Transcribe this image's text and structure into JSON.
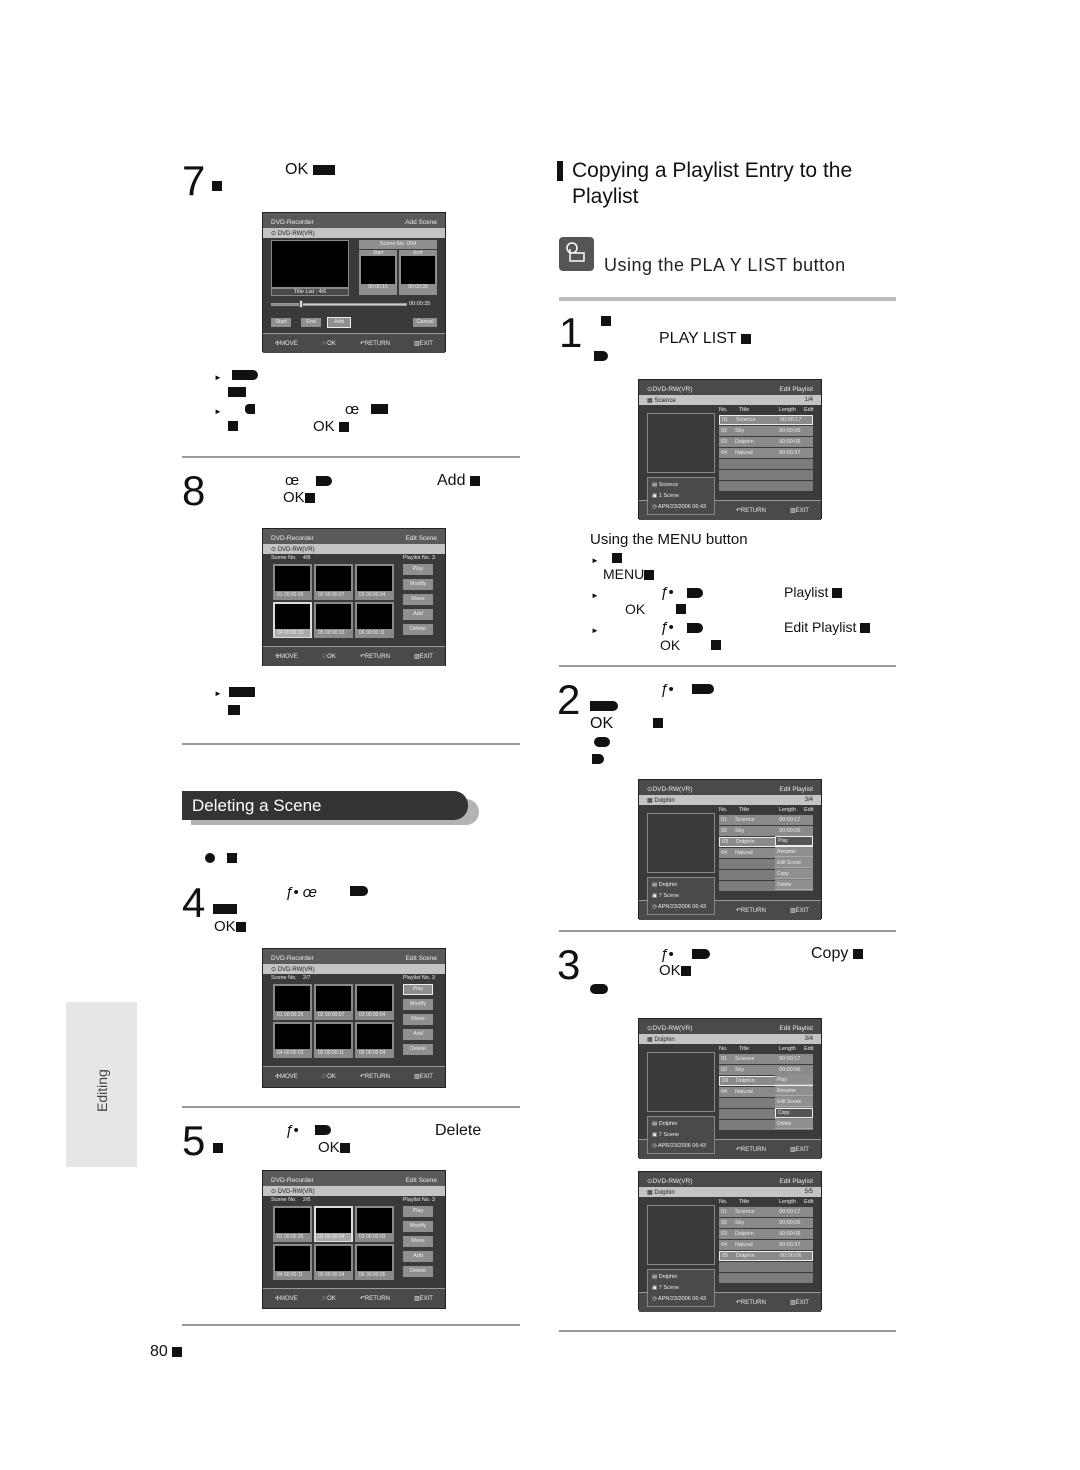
{
  "left": {
    "step7": {
      "num": "7",
      "ok": "OK"
    },
    "step7_notes": {
      "ok": "OK",
      "oe": "œ"
    },
    "step8": {
      "num": "8",
      "oe": "œ",
      "add": "Add",
      "ok": "OK"
    },
    "section": {
      "title": "Deleting a Scene"
    },
    "step4": {
      "num": "4",
      "f": "ƒ• œ",
      "ok": "OK"
    },
    "step5": {
      "num": "5",
      "f": "ƒ•",
      "ok": "OK",
      "delete": "Delete"
    },
    "page_number": "80"
  },
  "side_tab": {
    "label": "Editing"
  },
  "right": {
    "heading": {
      "line1": "Copying a Playlist Entry to the",
      "line2": "Playlist"
    },
    "subheading": "Using the PLA Y LIST button",
    "step1": {
      "num": "1",
      "playlist": "PLAY LIST"
    },
    "menu": {
      "title": "Using the MENU button",
      "menu": "MENU",
      "f": "ƒ•",
      "ok": "OK",
      "playlist": "Playlist",
      "edit_playlist": "Edit Playlist"
    },
    "step2": {
      "num": "2",
      "f": "ƒ•",
      "ok": "OK"
    },
    "step3": {
      "num": "3",
      "f": "ƒ•",
      "ok": "OK",
      "copy": "Copy"
    }
  },
  "osd_footer": {
    "move": "MOVE",
    "ok": "OK",
    "return": "RETURN",
    "exit": "EXIT"
  },
  "screen_add_scene": {
    "header_left": "DVD-Recorder",
    "header_right": "Add Scene",
    "disc": "DVD-RW(VR)",
    "scene_no": "Scene No. 004",
    "start_label": "Start",
    "end_label": "End",
    "title_list": "Title List : 4/6",
    "start_time": "00:00:15",
    "end_time": "00:00:35",
    "total_time": "00:00:35",
    "progress": 0.22,
    "buttons": [
      "Start",
      "End",
      "Add",
      "Cancel"
    ]
  },
  "screen_edit_scene_1": {
    "header_left": "DVD-Recorder",
    "header_right": "Edit Scene",
    "disc": "DVD-RW(VR)",
    "scene_label": "Scene No.",
    "scene_count": "4/8",
    "playlist": "Playlist No. 3",
    "thumbs": [
      "01  00:00:26",
      "02  00:00:07",
      "03  00:00:04",
      "04  00:00:20",
      "05  00:00:03",
      "06  00:00:11"
    ],
    "buttons": [
      "Play",
      "Modify",
      "Move",
      "Add",
      "Delete"
    ]
  },
  "screen_edit_scene_2": {
    "header_left": "DVD-Recorder",
    "header_right": "Edit Scene",
    "disc": "DVD-RW(VR)",
    "scene_label": "Scene No.",
    "scene_count": "2/7",
    "playlist": "Playlist No. 3",
    "thumbs": [
      "01  00:00:26",
      "02  00:00:07",
      "03  00:00:04",
      "04  00:00:03",
      "05  00:00:11",
      "06  00:00:04"
    ],
    "buttons": [
      "Play",
      "Modify",
      "Move",
      "Add",
      "Delete"
    ]
  },
  "screen_edit_scene_3": {
    "header_left": "DVD-Recorder",
    "header_right": "Edit Scene",
    "disc": "DVD-RW(VR)",
    "scene_label": "Scene No.",
    "scene_count": "2/6",
    "playlist": "Playlist No. 3",
    "thumbs": [
      "01  00:00:26",
      "02  00:00:04",
      "03  00:00:03",
      "04  00:00:11",
      "05  00:00:04",
      "06  00:00:05"
    ],
    "buttons": [
      "Play",
      "Modify",
      "Move",
      "Add",
      "Delete"
    ]
  },
  "playlist_cols": {
    "no": "No.",
    "title": "Title",
    "length": "Length",
    "edit": "Edit"
  },
  "screen_playlist_1": {
    "disc": "DVD-RW(VR)",
    "header_right": "Edit Playlist",
    "current": "Science",
    "count": "1/4",
    "info": [
      "Science",
      "1 Scene",
      "APR/23/2006 06:43"
    ],
    "rows": [
      [
        "01",
        "Science",
        "00:00:17"
      ],
      [
        "02",
        "Sky",
        "00:00:06"
      ],
      [
        "03",
        "Dolphin",
        "00:00:06"
      ],
      [
        "04",
        "Natural",
        "00:00:37"
      ]
    ]
  },
  "screen_playlist_2": {
    "disc": "DVD-RW(VR)",
    "header_right": "Edit Playlist",
    "current": "Dolphin",
    "count": "3/4",
    "info": [
      "Dolphin",
      "7 Scene",
      "APR/23/2006 06:43"
    ],
    "rows": [
      [
        "01",
        "Science",
        "00:00:17"
      ],
      [
        "02",
        "Sky",
        "00:00:06"
      ],
      [
        "03",
        "Dolphin",
        ""
      ],
      [
        "04",
        "Natural",
        ""
      ]
    ],
    "popup": [
      "Play",
      "Rename",
      "Edit Scene",
      "Copy",
      "Delete"
    ]
  },
  "screen_playlist_3": {
    "disc": "DVD-RW(VR)",
    "header_right": "Edit Playlist",
    "current": "Dolphin",
    "count": "3/4",
    "info": [
      "Dolphin",
      "7 Scene",
      "APR/23/2006 06:43"
    ],
    "rows": [
      [
        "01",
        "Science",
        "00:00:17"
      ],
      [
        "02",
        "Sky",
        "00:00:06"
      ],
      [
        "03",
        "Dolphin",
        ""
      ],
      [
        "04",
        "Natural",
        ""
      ]
    ],
    "popup": [
      "Play",
      "Rename",
      "Edit Scene",
      "Copy",
      "Delete"
    ]
  },
  "screen_playlist_4": {
    "disc": "DVD-RW(VR)",
    "header_right": "Edit Playlist",
    "current": "Dolphin",
    "count": "5/5",
    "info": [
      "Dolphin",
      "7 Scene",
      "APR/23/2006 06:43"
    ],
    "rows": [
      [
        "01",
        "Science",
        "00:00:17"
      ],
      [
        "02",
        "Sky",
        "00:00:06"
      ],
      [
        "03",
        "Dolphin",
        "00:00:06"
      ],
      [
        "04",
        "Natural",
        "00:00:37"
      ],
      [
        "05",
        "Dolphin",
        "00:00:06"
      ]
    ]
  }
}
